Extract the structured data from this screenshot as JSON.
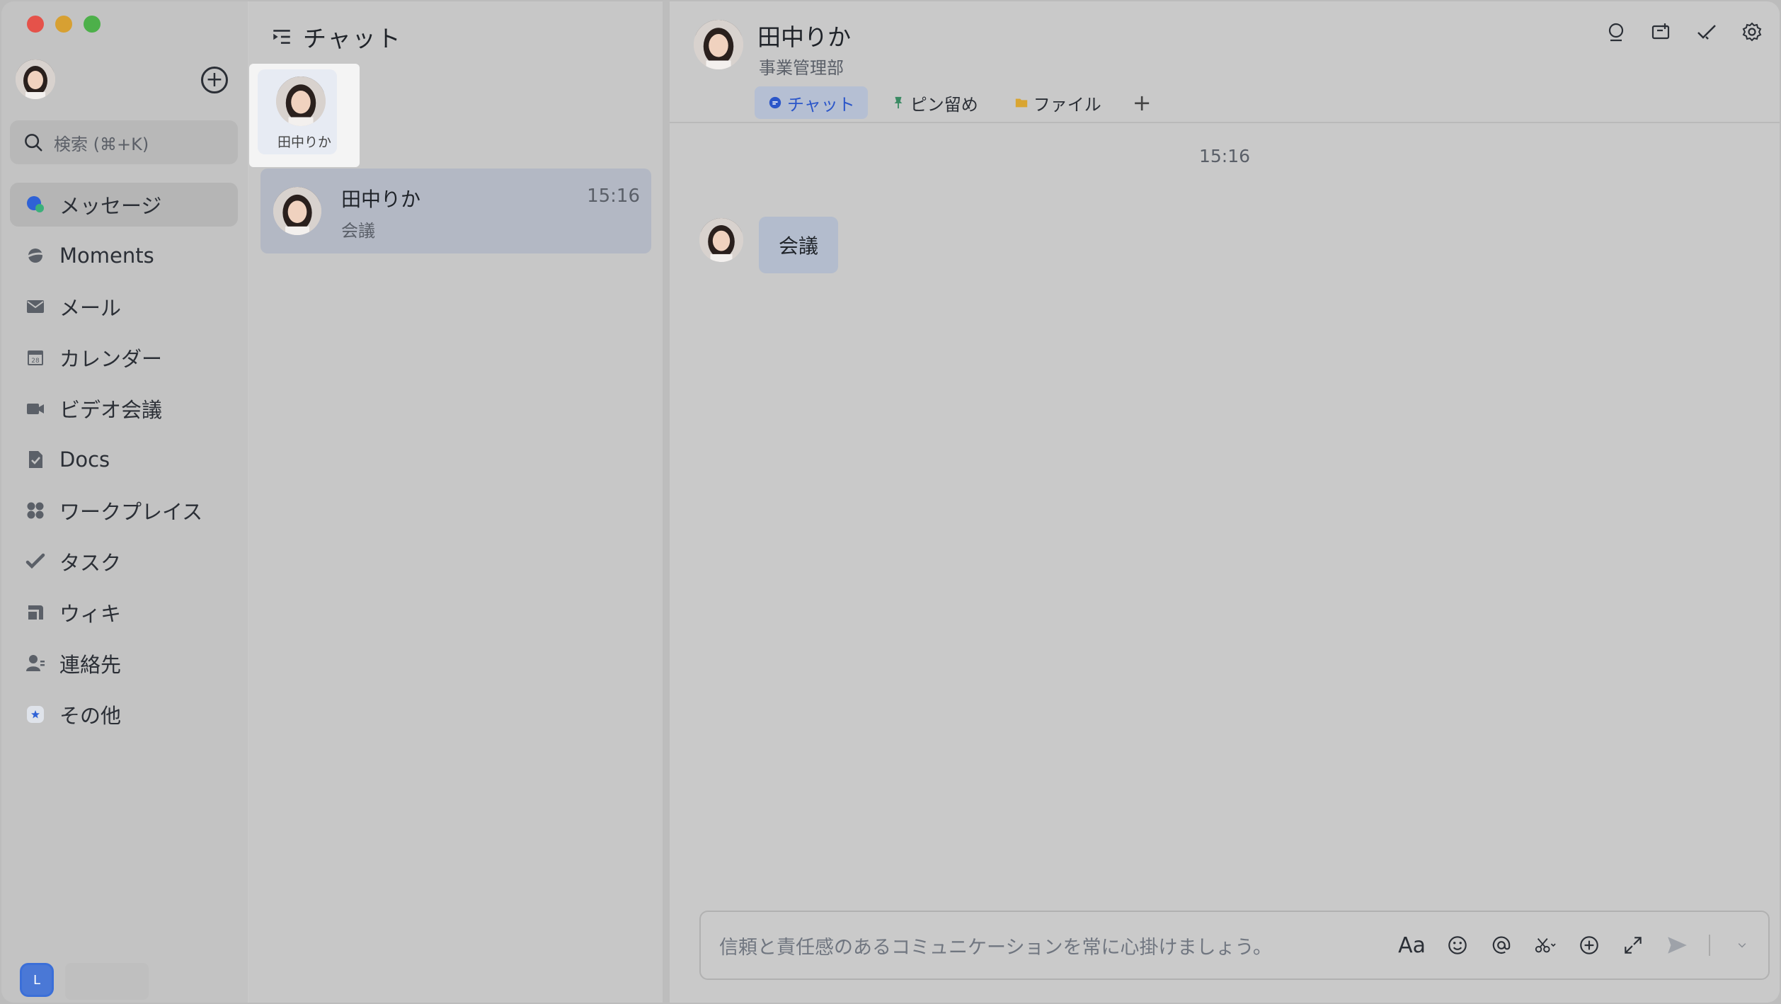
{
  "sidebar": {
    "search_placeholder": "検索 (⌘+K)",
    "items": [
      {
        "label": "メッセージ",
        "icon": "message-icon",
        "active": true
      },
      {
        "label": "Moments",
        "icon": "moments-icon"
      },
      {
        "label": "メール",
        "icon": "mail-icon"
      },
      {
        "label": "カレンダー",
        "icon": "calendar-icon"
      },
      {
        "label": "ビデオ会議",
        "icon": "video-icon"
      },
      {
        "label": "Docs",
        "icon": "docs-icon"
      },
      {
        "label": "ワークプレイス",
        "icon": "workplace-icon"
      },
      {
        "label": "タスク",
        "icon": "task-icon"
      },
      {
        "label": "ウィキ",
        "icon": "wiki-icon"
      },
      {
        "label": "連絡先",
        "icon": "contacts-icon"
      },
      {
        "label": "その他",
        "icon": "more-icon"
      }
    ],
    "calendar_day": "28",
    "bottom_user_initial": "L"
  },
  "chatlist": {
    "title": "チャット",
    "pinned": {
      "name": "田中りか"
    },
    "conversations": [
      {
        "name": "田中りか",
        "time": "15:16",
        "preview": "会議"
      }
    ]
  },
  "chat": {
    "title": "田中りか",
    "subtitle": "事業管理部",
    "tabs": [
      {
        "label": "チャット",
        "icon": "chat-bubble-icon",
        "active": true,
        "color": "#2b56c9"
      },
      {
        "label": "ピン留め",
        "icon": "pin-icon",
        "color": "#3a8a63"
      },
      {
        "label": "ファイル",
        "icon": "folder-icon",
        "color": "#d9a531"
      }
    ],
    "tab_add": "+",
    "time_divider": "15:16",
    "messages": [
      {
        "sender": "田中りか",
        "text": "会議"
      }
    ],
    "composer_placeholder": "信頼と責任感のあるコミュニケーションを常に心掛けましょう。",
    "format_label": "Aa"
  },
  "colors": {
    "accent": "#2b56c9",
    "active_tab_bg": "#b5bfd3",
    "selected_conversation_bg": "#b3b8c4"
  }
}
